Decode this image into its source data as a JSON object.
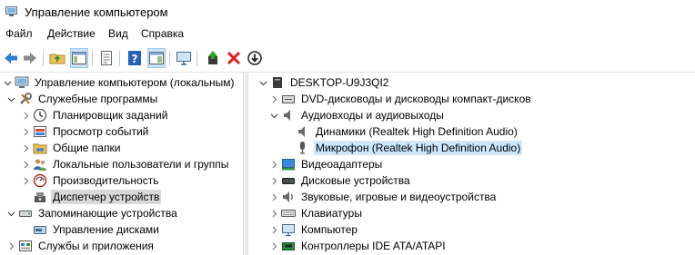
{
  "window": {
    "title": "Управление компьютером"
  },
  "menu": {
    "file": "Файл",
    "action": "Действие",
    "view": "Вид",
    "help": "Справка"
  },
  "toolbar": {
    "buttons": [
      "back-icon",
      "forward-icon",
      "up-folder-icon",
      "show-hide-tree-icon",
      "properties-icon",
      "help-icon",
      "show-action-pane-icon",
      "monitor-icon",
      "update-driver-icon",
      "uninstall-icon",
      "disable-icon"
    ]
  },
  "left_tree": {
    "root": "Управление компьютером (локальным)",
    "system_tools": "Служебные программы",
    "task_scheduler": "Планировщик заданий",
    "event_viewer": "Просмотр событий",
    "shared_folders": "Общие папки",
    "local_users": "Локальные пользователи и группы",
    "performance": "Производительность",
    "device_manager": "Диспетчер устройств",
    "storage": "Запоминающие устройства",
    "disk_management": "Управление дисками",
    "services_apps": "Службы и приложения"
  },
  "right_tree": {
    "computer_name": "DESKTOP-U9J3QI2",
    "dvd": "DVD-дисководы и дисководы компакт-дисков",
    "audio_io": "Аудиовходы и аудиовыходы",
    "speakers": "Динамики (Realtek High Definition Audio)",
    "microphone": "Микрофон (Realtek High Definition Audio)",
    "video": "Видеоадаптеры",
    "disks": "Дисковые устройства",
    "sound": "Звуковые, игровые и видеоустройства",
    "keyboards": "Клавиатуры",
    "computer": "Компьютер",
    "ide": "Контроллеры IDE ATA/ATAPI"
  },
  "colors": {
    "selection": "#cce8ff",
    "inactive_selection": "#d9d9d9",
    "toolbar_pressed": "#cce4f7"
  }
}
